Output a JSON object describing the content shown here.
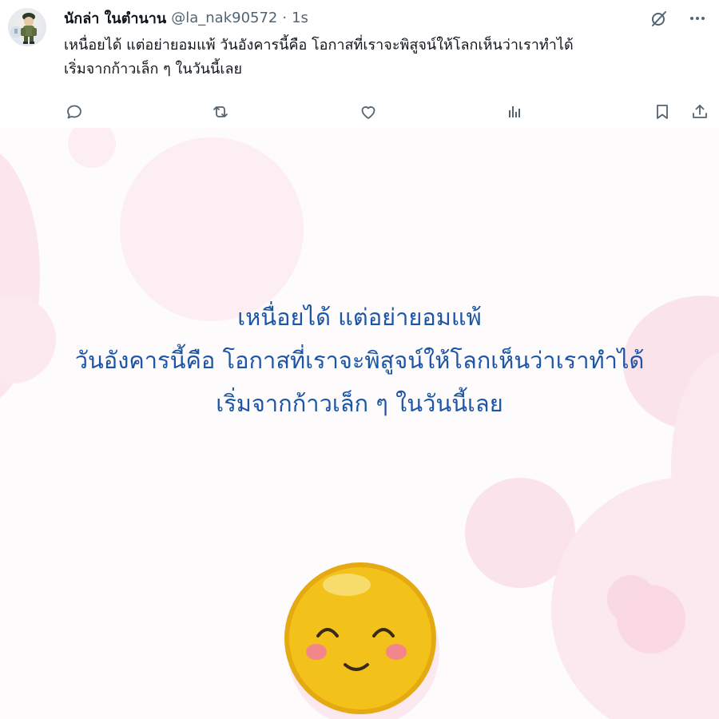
{
  "post": {
    "display_name": "นักล่า ในตำนาน",
    "handle": "@la_nak90572",
    "separator": "·",
    "time": "1s",
    "text_line1": "เหนื่อยได้ แต่อย่ายอมแพ้ วันอังคารนี้คือ โอกาสที่เราจะพิสูจน์ให้โลกเห็นว่าเราทำได้",
    "text_line2": "เริ่มจากก้าวเล็ก ๆ ในวันนี้เลย"
  },
  "header_icons": [
    "grok-icon",
    "more-icon"
  ],
  "actions": [
    "reply-icon",
    "repost-icon",
    "like-icon",
    "views-icon",
    "bookmark-icon",
    "share-icon"
  ],
  "image": {
    "line1": "เหนื่อยได้ แต่อย่ายอมแพ้",
    "line2": "วันอังคารนี้คือ โอกาสที่เราจะพิสูจน์ให้โลกเห็นว่าเราทำได้",
    "line3": "เริ่มจากก้าวเล็ก ๆ ในวันนี้เลย"
  },
  "colors": {
    "text_primary": "#0f1419",
    "text_secondary": "#536471",
    "image_text": "#1c55a6",
    "bubble_pink": "#fbe3ec",
    "emoji_yellow": "#f2c21b"
  }
}
